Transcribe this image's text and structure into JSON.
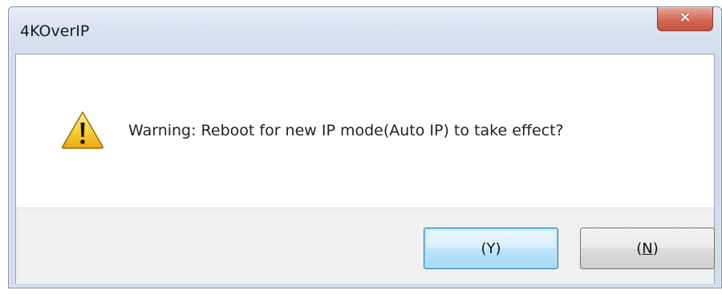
{
  "window": {
    "title": "4KOverIP",
    "close_glyph": "×"
  },
  "dialog": {
    "icon": "warning-icon",
    "message": "Warning: Reboot for new IP mode(Auto IP) to take effect?"
  },
  "buttons": {
    "yes_label": "(Y)",
    "no_label_prefix": "(",
    "no_label_key": "N",
    "no_label_suffix": ")"
  },
  "colors": {
    "close_button": "#d26a55",
    "default_button_border": "#3c7fb1",
    "warning_icon": "#f5c518"
  }
}
